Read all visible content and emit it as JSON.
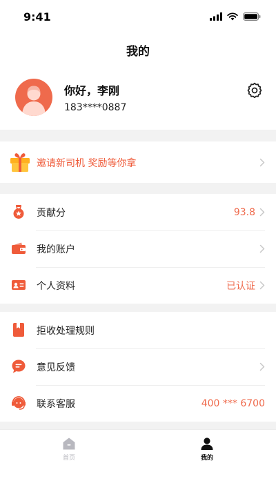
{
  "status_bar": {
    "time": "9:41"
  },
  "nav": {
    "title": "我的"
  },
  "profile": {
    "greeting": "你好，李刚",
    "phone": "183****0887"
  },
  "invite": {
    "text": "邀请新司机 奖励等你拿"
  },
  "menu_group_1": [
    {
      "label": "贡献分",
      "value": "93.8",
      "icon": "medal-icon"
    },
    {
      "label": "我的账户",
      "value": "",
      "icon": "wallet-icon"
    },
    {
      "label": "个人资料",
      "value": "已认证",
      "icon": "id-card-icon"
    }
  ],
  "menu_group_2": [
    {
      "label": "拒收处理规则",
      "value": "",
      "icon": "book-icon"
    },
    {
      "label": "意见反馈",
      "value": "",
      "icon": "message-icon"
    },
    {
      "label": "联系客服",
      "value": "400 *** 6700",
      "icon": "headset-icon"
    }
  ],
  "tabbar": {
    "home_label": "首页",
    "mine_label": "我的"
  },
  "colors": {
    "accent": "#ef6a4c",
    "accent_text": "#ef5b3a",
    "background": "#f2f2f2"
  }
}
